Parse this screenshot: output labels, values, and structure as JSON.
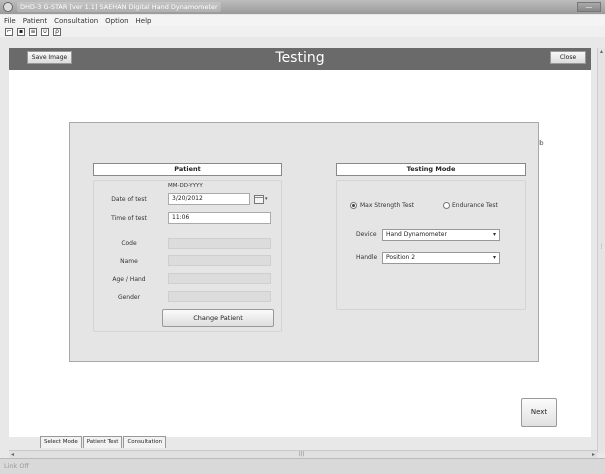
{
  "window": {
    "title": "DHD-3 G-STAR [ver 1.1] SAEHAN Digital Hand Dynamometer",
    "minimize_label": "—"
  },
  "menu": {
    "items": [
      "File",
      "Patient",
      "Consultation",
      "Option",
      "Help"
    ]
  },
  "toolbar": {
    "icons": [
      "open-icon",
      "save-icon",
      "settings-icon",
      "grip-icon",
      "key-icon"
    ]
  },
  "header": {
    "title": "Testing",
    "save_image_label": "Save Image",
    "close_label": "Close"
  },
  "unit_label": "Unit: lb",
  "patient": {
    "header": "Patient",
    "date_format_hint": "MM-DD-YYYY",
    "date_label": "Date of test",
    "date_value": "3/20/2012",
    "time_label": "Time of test",
    "time_value": "11:06",
    "code_label": "Code",
    "name_label": "Name",
    "age_hand_label": "Age / Hand",
    "gender_label": "Gender",
    "change_patient_label": "Change Patient"
  },
  "testing_mode": {
    "header": "Testing Mode",
    "max_strength_label": "Max Strength Test",
    "endurance_label": "Endurance Test",
    "selected": "Max Strength Test",
    "device_label": "Device",
    "device_value": "Hand Dynamometer",
    "handle_label": "Handle",
    "handle_value": "Position 2"
  },
  "next_label": "Next",
  "tabs": [
    "Select Mode",
    "Patient Test",
    "Consultation"
  ],
  "status": {
    "text": "Link Off"
  },
  "colors": {
    "header_strip": "#6a6a6a",
    "panel_bg": "#e5e5e5",
    "titlebar": "#a8a8a8"
  }
}
